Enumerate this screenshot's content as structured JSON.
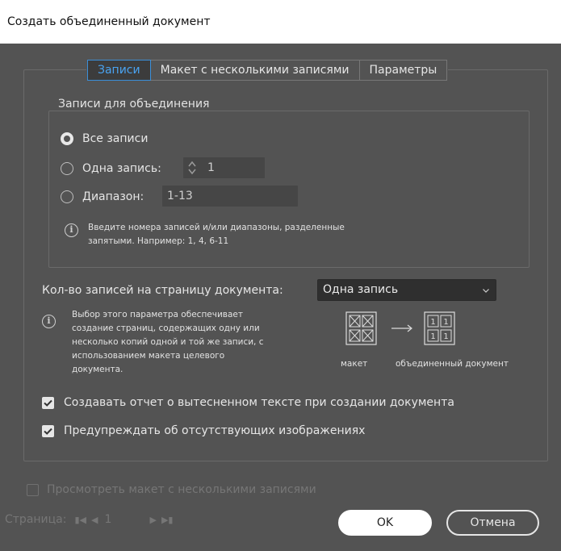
{
  "window": {
    "title": "Создать объединенный документ"
  },
  "tabs": [
    {
      "label": "Записи",
      "active": true
    },
    {
      "label": "Макет с несколькими записями",
      "active": false
    },
    {
      "label": "Параметры",
      "active": false
    }
  ],
  "records_group": {
    "title": "Записи для объединения",
    "options": [
      {
        "label": "Все записи",
        "selected": true
      },
      {
        "label": "Одна запись:",
        "selected": false,
        "value": "1"
      },
      {
        "label": "Диапазон:",
        "selected": false,
        "value": "1-13"
      }
    ],
    "hint_line1": "Введите номера записей и/или диапазоны, разделенные",
    "hint_line2": "запятыми. Например: 1, 4, 6-11"
  },
  "records_per_page": {
    "label": "Кол-во записей на страницу документа:",
    "selected": "Одна запись",
    "hint_lines": [
      "Выбор этого параметра обеспечивает",
      "создание страниц, содержащих одну или",
      "несколько копий одной и той же записи, с",
      "использованием макета целевого",
      "документа."
    ],
    "diagram": {
      "source_label": "макет",
      "target_label": "объединенный документ",
      "cell_glyph": "1"
    }
  },
  "checkboxes": [
    {
      "label": "Создавать отчет о вытесненном тексте при создании документа",
      "checked": true
    },
    {
      "label": "Предупреждать об отсутствующих изображениях",
      "checked": true
    }
  ],
  "preview": {
    "label": "Просмотреть макет с несколькими записями",
    "checked": false,
    "enabled": false
  },
  "page_nav": {
    "label": "Страница:",
    "value": "1"
  },
  "buttons": {
    "ok": "OK",
    "cancel": "Отмена"
  },
  "colors": {
    "background": "#535353",
    "accent": "#3b8fd9",
    "field": "#464646"
  }
}
